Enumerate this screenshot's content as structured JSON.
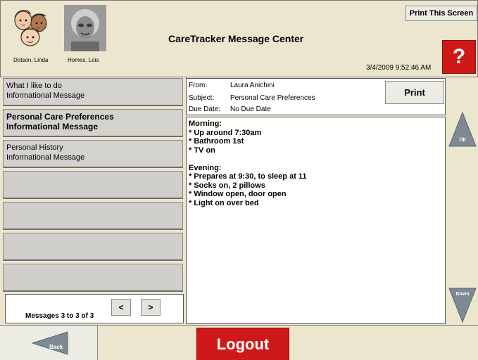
{
  "header": {
    "title": "CareTracker Message Center",
    "timestamp": "3/4/2009 9:52:46 AM",
    "print_screen_label": "Print This Screen",
    "help_label": "?",
    "residents": [
      {
        "name": "Dotson, Linda"
      },
      {
        "name": "Homes, Lois"
      }
    ]
  },
  "messages": [
    {
      "title": "What I like to do",
      "type": "Informational Message",
      "selected": false
    },
    {
      "title": "Personal Care Preferences",
      "type": "Informational Message",
      "selected": true
    },
    {
      "title": "Personal History",
      "type": "Informational Message",
      "selected": false
    },
    {
      "title": "",
      "type": "",
      "selected": false
    },
    {
      "title": "",
      "type": "",
      "selected": false
    },
    {
      "title": "",
      "type": "",
      "selected": false
    },
    {
      "title": "",
      "type": "",
      "selected": false
    }
  ],
  "pager": {
    "text": "Messages 3 to 3 of 3",
    "prev_label": "<",
    "next_label": ">"
  },
  "detail": {
    "from_label": "From:",
    "from_value": "Laura Anichini",
    "subject_label": "Subject:",
    "subject_value": "Personal Care Preferences",
    "due_label": "Due Date:",
    "due_value": "No Due Date",
    "print_label": "Print",
    "body": [
      "Morning:",
      "* Up around 7:30am",
      "* Bathroom 1st",
      "* TV on",
      "",
      "Evening:",
      "* Prepares at 9:30, to sleep at 11",
      "* Socks on, 2 pillows",
      "* Window open, door open",
      "* Light on over bed"
    ]
  },
  "scroll": {
    "up_label": "Up",
    "down_label": "Down"
  },
  "footer": {
    "back_label": "Back",
    "logout_label": "Logout"
  },
  "colors": {
    "background": "#ece6cf",
    "accent_red": "#cf1818",
    "arrow_gray": "#7d8a93"
  }
}
